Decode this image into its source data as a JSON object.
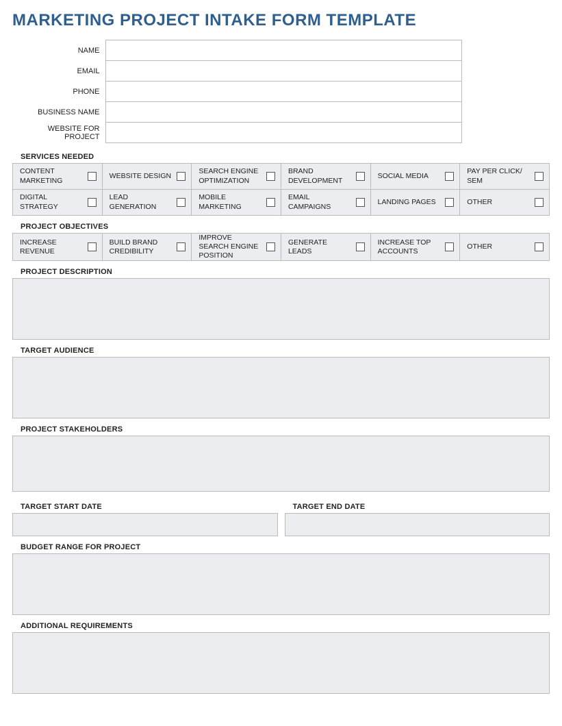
{
  "title": "MARKETING PROJECT INTAKE FORM TEMPLATE",
  "info_fields": {
    "name": "NAME",
    "email": "EMAIL",
    "phone": "PHONE",
    "business_name": "BUSINESS NAME",
    "website": "WEBSITE FOR PROJECT"
  },
  "services": {
    "heading": "SERVICES NEEDED",
    "row1": [
      "CONTENT MARKETING",
      "WEBSITE DESIGN",
      "SEARCH ENGINE OPTIMIZATION",
      "BRAND DEVELOPMENT",
      "SOCIAL MEDIA",
      "PAY PER CLICK/ SEM"
    ],
    "row2": [
      "DIGITAL STRATEGY",
      "LEAD GENERATION",
      "MOBILE MARKETING",
      "EMAIL CAMPAIGNS",
      "LANDING PAGES",
      "OTHER"
    ]
  },
  "objectives": {
    "heading": "PROJECT OBJECTIVES",
    "row1": [
      "INCREASE REVENUE",
      "BUILD BRAND CREDIBILITY",
      "IMPROVE SEARCH ENGINE POSITION",
      "GENERATE LEADS",
      "INCREASE TOP ACCOUNTS",
      "OTHER"
    ]
  },
  "sections": {
    "description": "PROJECT DESCRIPTION",
    "audience": "TARGET AUDIENCE",
    "stakeholders": "PROJECT STAKEHOLDERS",
    "start_date": "TARGET START DATE",
    "end_date": "TARGET END DATE",
    "budget": "BUDGET RANGE FOR PROJECT",
    "additional": "ADDITIONAL REQUIREMENTS"
  }
}
